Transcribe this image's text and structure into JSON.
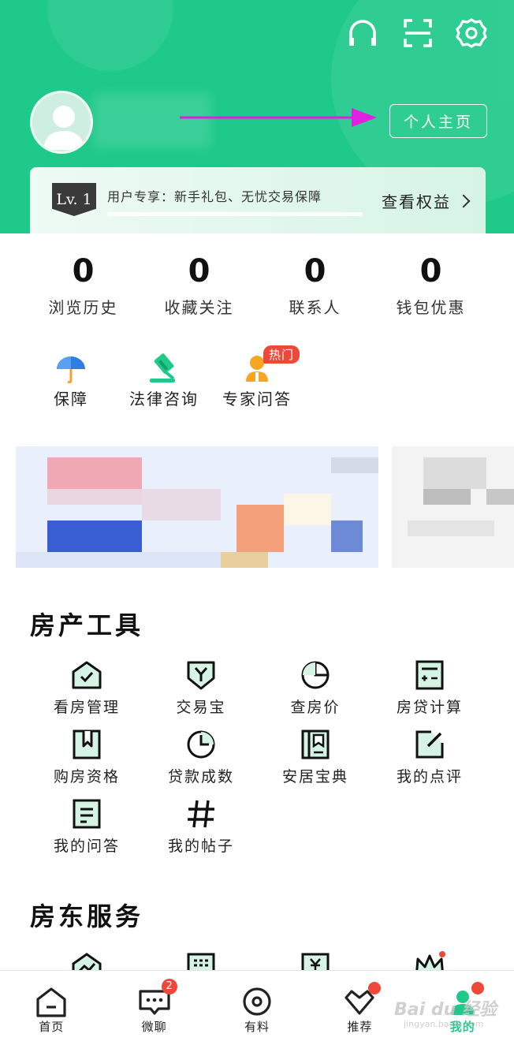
{
  "header": {
    "profile_button": "个人主页",
    "icons": [
      "headset-icon",
      "scan-icon",
      "settings-icon"
    ]
  },
  "member": {
    "level": "Lv. 1",
    "text": "用户专享：新手礼包、无忧交易保障",
    "rights_link": "查看权益"
  },
  "stats": [
    {
      "value": "0",
      "label": "浏览历史"
    },
    {
      "value": "0",
      "label": "收藏关注"
    },
    {
      "value": "0",
      "label": "联系人"
    },
    {
      "value": "0",
      "label": "钱包优惠"
    }
  ],
  "quick": [
    {
      "label": "保障"
    },
    {
      "label": "法律咨询"
    },
    {
      "label": "专家问答",
      "badge": "热门"
    }
  ],
  "property_tools": {
    "title": "房产工具",
    "items": [
      {
        "label": "看房管理",
        "icon": "house-check-icon"
      },
      {
        "label": "交易宝",
        "icon": "shield-y-icon"
      },
      {
        "label": "查房价",
        "icon": "pie-chart-icon"
      },
      {
        "label": "房贷计算",
        "icon": "calculator-icon"
      },
      {
        "label": "购房资格",
        "icon": "bookmark-icon"
      },
      {
        "label": "贷款成数",
        "icon": "clock-pie-icon"
      },
      {
        "label": "安居宝典",
        "icon": "book-icon"
      },
      {
        "label": "我的点评",
        "icon": "edit-icon"
      },
      {
        "label": "我的问答",
        "icon": "qa-list-icon"
      },
      {
        "label": "我的帖子",
        "icon": "hash-icon"
      }
    ]
  },
  "landlord": {
    "title": "房东服务"
  },
  "tabbar": [
    {
      "label": "首页",
      "icon": "home-icon"
    },
    {
      "label": "微聊",
      "icon": "chat-icon",
      "badge": "2"
    },
    {
      "label": "有料",
      "icon": "disc-icon"
    },
    {
      "label": "推荐",
      "icon": "heart-check-icon"
    },
    {
      "label": "我的",
      "icon": "me-icon"
    }
  ],
  "watermark": {
    "main": "Bai du 经验",
    "sub": "jingyan.baidu.com"
  },
  "colors": {
    "brand": "#1fc98a",
    "badge": "#f04838",
    "arrow": "#e020e0"
  }
}
